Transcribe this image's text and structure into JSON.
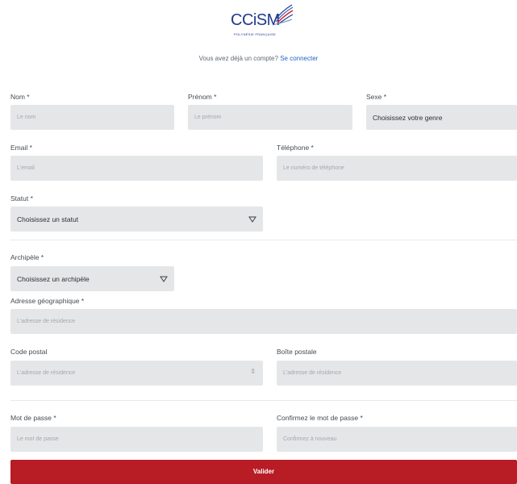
{
  "logo": {
    "text": "CCiSM",
    "subtitle": "POLYNÉSIE FRANÇAISE"
  },
  "login": {
    "prompt": "Vous avez déjà un compte?",
    "link": "Se connecter"
  },
  "form": {
    "nom": {
      "label": "Nom *",
      "placeholder": "Le nom"
    },
    "prenom": {
      "label": "Prénom *",
      "placeholder": "Le prénom"
    },
    "sexe": {
      "label": "Sexe *",
      "value": "Choisissez votre genre"
    },
    "email": {
      "label": "Email *",
      "placeholder": "L'email"
    },
    "telephone": {
      "label": "Téléphone *",
      "placeholder": "Le numéro de téléphone"
    },
    "statut": {
      "label": "Statut *",
      "value": "Choisissez un statut"
    },
    "archipel": {
      "label": "Archipèle *",
      "value": "Choisissez un archipèle"
    },
    "adresse": {
      "label": "Adresse géographique *",
      "placeholder": "L'adresse de résidence"
    },
    "code_postal": {
      "label": "Code postal",
      "placeholder": "L'adresse de résidence"
    },
    "boite_postale": {
      "label": "Boîte postale",
      "placeholder": "L'adresse de résidence"
    },
    "mot_de_passe": {
      "label": "Mot de passe *",
      "placeholder": "Le mot de passe"
    },
    "confirmation": {
      "label": "Confirmez le mot de passe *",
      "placeholder": "Confirmez à nouveau"
    },
    "submit": "Valider"
  },
  "colors": {
    "brand": "#1f3a8a",
    "link": "#2563c9",
    "submit": "#b81c24",
    "field_bg": "#e5e6e8"
  }
}
